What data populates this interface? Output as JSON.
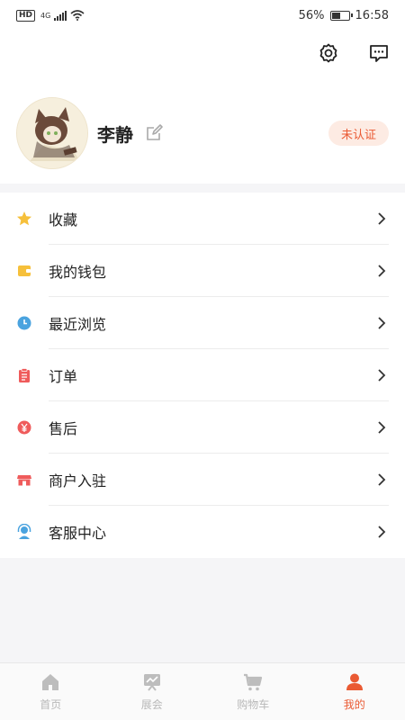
{
  "status_bar": {
    "hd": "HD",
    "network": "4G",
    "battery_percent": "56%",
    "battery_level": 0.56,
    "time": "16:58"
  },
  "header": {
    "username": "李静",
    "verify_label": "未认证"
  },
  "menu": [
    {
      "label": "收藏",
      "icon": "star-icon",
      "color": "#f6c03b"
    },
    {
      "label": "我的钱包",
      "icon": "wallet-icon",
      "color": "#f6c03b"
    },
    {
      "label": "最近浏览",
      "icon": "clock-icon",
      "color": "#4aa3df"
    },
    {
      "label": "订单",
      "icon": "clipboard-icon",
      "color": "#ef5b5b"
    },
    {
      "label": "售后",
      "icon": "yen-icon",
      "color": "#ef5b5b"
    },
    {
      "label": "商户入驻",
      "icon": "shop-icon",
      "color": "#ef5b5b"
    },
    {
      "label": "客服中心",
      "icon": "headset-icon",
      "color": "#4aa3df"
    }
  ],
  "tabbar": {
    "items": [
      {
        "label": "首页",
        "icon": "home-icon"
      },
      {
        "label": "展会",
        "icon": "exhibition-icon"
      },
      {
        "label": "购物车",
        "icon": "cart-icon"
      },
      {
        "label": "我的",
        "icon": "profile-icon",
        "active": true
      }
    ]
  },
  "colors": {
    "accent": "#ea5a33",
    "badge_bg": "#fdebe3",
    "tab_inactive": "#b8b8b8"
  }
}
